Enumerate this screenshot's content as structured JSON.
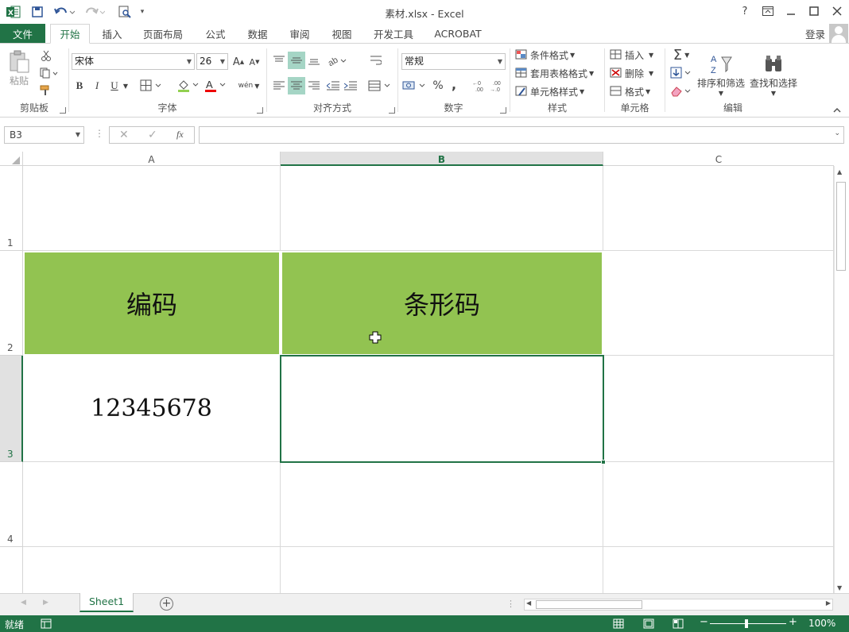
{
  "window": {
    "title": "素材.xlsx - Excel",
    "help": "?",
    "login": "登录"
  },
  "tabs": {
    "file": "文件",
    "items": [
      "开始",
      "插入",
      "页面布局",
      "公式",
      "数据",
      "审阅",
      "视图",
      "开发工具",
      "ACROBAT"
    ]
  },
  "ribbon": {
    "clipboard": {
      "paste": "粘贴",
      "label": "剪贴板"
    },
    "font": {
      "name": "宋体",
      "size": "26",
      "label": "字体",
      "bold": "B",
      "italic": "I",
      "underline": "U",
      "phonetic": "wén"
    },
    "alignment": {
      "label": "对齐方式"
    },
    "number": {
      "format": "常规",
      "label": "数字",
      "percent": "%",
      "comma": ","
    },
    "styles": {
      "conditional": "条件格式",
      "table": "套用表格格式",
      "cell": "单元格样式",
      "label": "样式"
    },
    "cells": {
      "insert": "插入",
      "delete": "删除",
      "format": "格式",
      "label": "单元格"
    },
    "editing": {
      "sort": "排序和筛选",
      "find": "查找和选择",
      "label": "编辑"
    }
  },
  "formula_bar": {
    "name_box": "B3",
    "fx": "fx",
    "value": ""
  },
  "grid": {
    "columns": [
      "A",
      "B",
      "C"
    ],
    "rows": [
      "1",
      "2",
      "3",
      "4"
    ],
    "cells": {
      "A2": "编码",
      "B2": "条形码",
      "A3": "12345678",
      "B3": ""
    }
  },
  "sheets": {
    "active": "Sheet1"
  },
  "status": {
    "ready": "就绪",
    "zoom": "100%"
  },
  "colors": {
    "accent": "#217346",
    "header_fill": "#92c351"
  }
}
